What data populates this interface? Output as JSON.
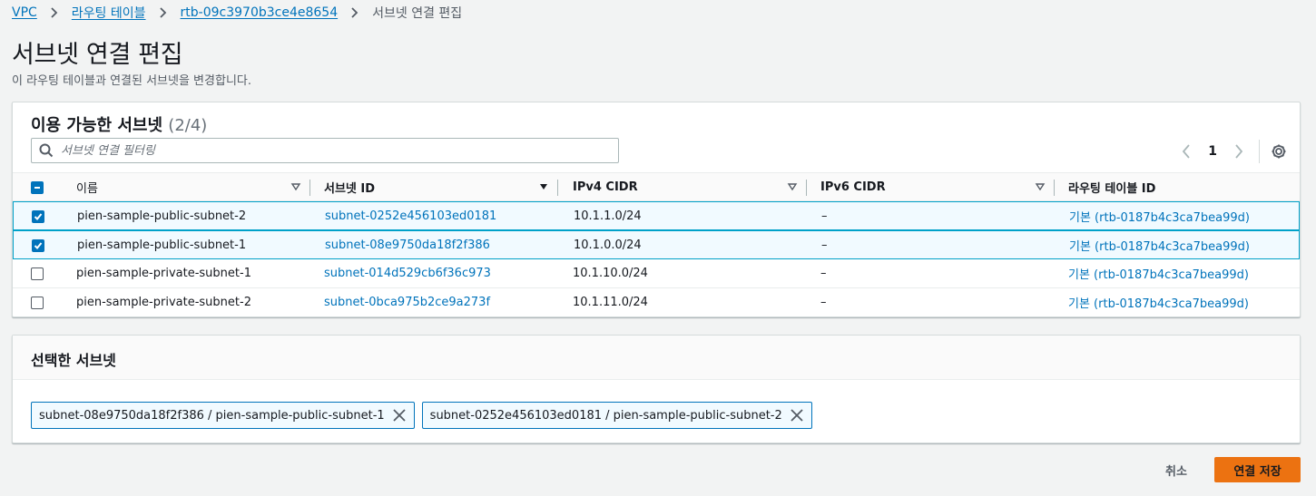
{
  "breadcrumb": {
    "items": [
      "VPC",
      "라우팅 테이블",
      "rtb-09c3970b3ce4e8654"
    ],
    "current": "서브넷 연결 편집"
  },
  "page": {
    "title": "서브넷 연결 편집",
    "description": "이 라우팅 테이블과 연결된 서브넷을 변경합니다."
  },
  "available": {
    "title": "이용 가능한 서브넷",
    "count": "(2/4)",
    "filter_placeholder": "서브넷 연결 필터링",
    "page": "1",
    "columns": [
      "이름",
      "서브넷 ID",
      "IPv4 CIDR",
      "IPv6 CIDR",
      "라우팅 테이블 ID"
    ],
    "rows": [
      {
        "checked": true,
        "name": "pien-sample-public-subnet-2",
        "subnet_id": "subnet-0252e456103ed0181",
        "ipv4": "10.1.1.0/24",
        "ipv6": "–",
        "route_table": "기본 (rtb-0187b4c3ca7bea99d)"
      },
      {
        "checked": true,
        "name": "pien-sample-public-subnet-1",
        "subnet_id": "subnet-08e9750da18f2f386",
        "ipv4": "10.1.0.0/24",
        "ipv6": "–",
        "route_table": "기본 (rtb-0187b4c3ca7bea99d)"
      },
      {
        "checked": false,
        "name": "pien-sample-private-subnet-1",
        "subnet_id": "subnet-014d529cb6f36c973",
        "ipv4": "10.1.10.0/24",
        "ipv6": "–",
        "route_table": "기본 (rtb-0187b4c3ca7bea99d)"
      },
      {
        "checked": false,
        "name": "pien-sample-private-subnet-2",
        "subnet_id": "subnet-0bca975b2ce9a273f",
        "ipv4": "10.1.11.0/24",
        "ipv6": "–",
        "route_table": "기본 (rtb-0187b4c3ca7bea99d)"
      }
    ]
  },
  "selected": {
    "title": "선택한 서브넷",
    "tokens": [
      "subnet-08e9750da18f2f386 / pien-sample-public-subnet-1",
      "subnet-0252e456103ed0181 / pien-sample-public-subnet-2"
    ]
  },
  "actions": {
    "cancel": "취소",
    "save": "연결 저장"
  },
  "colors": {
    "link": "#0073bb",
    "primary_button": "#ec7211",
    "selected_row_bg": "#f1faff",
    "selected_row_border": "#00a1c9"
  },
  "icons": [
    "chevron-right-icon",
    "search-icon",
    "chevron-left-icon",
    "gear-icon",
    "sort-caret-icon",
    "checkbox-icon",
    "close-icon"
  ]
}
